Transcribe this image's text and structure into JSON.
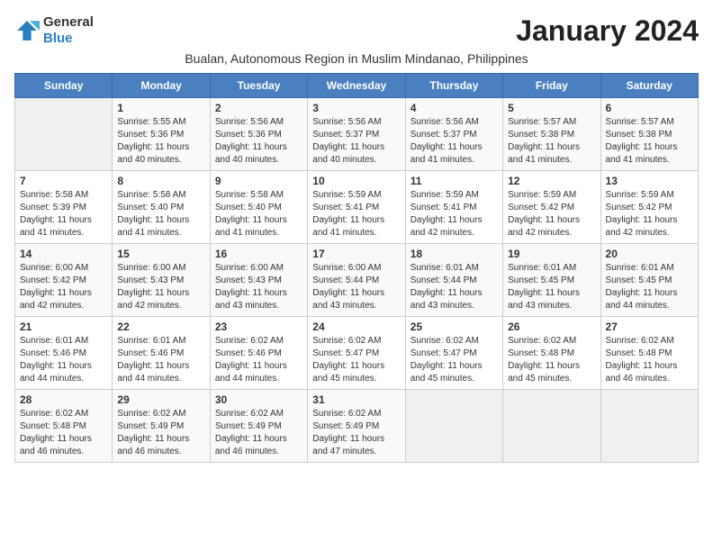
{
  "header": {
    "logo": {
      "general": "General",
      "blue": "Blue"
    },
    "month": "January 2024",
    "subtitle": "Bualan, Autonomous Region in Muslim Mindanao, Philippines"
  },
  "days_of_week": [
    "Sunday",
    "Monday",
    "Tuesday",
    "Wednesday",
    "Thursday",
    "Friday",
    "Saturday"
  ],
  "weeks": [
    [
      {
        "day": "",
        "detail": ""
      },
      {
        "day": "1",
        "detail": "Sunrise: 5:55 AM\nSunset: 5:36 PM\nDaylight: 11 hours\nand 40 minutes."
      },
      {
        "day": "2",
        "detail": "Sunrise: 5:56 AM\nSunset: 5:36 PM\nDaylight: 11 hours\nand 40 minutes."
      },
      {
        "day": "3",
        "detail": "Sunrise: 5:56 AM\nSunset: 5:37 PM\nDaylight: 11 hours\nand 40 minutes."
      },
      {
        "day": "4",
        "detail": "Sunrise: 5:56 AM\nSunset: 5:37 PM\nDaylight: 11 hours\nand 41 minutes."
      },
      {
        "day": "5",
        "detail": "Sunrise: 5:57 AM\nSunset: 5:38 PM\nDaylight: 11 hours\nand 41 minutes."
      },
      {
        "day": "6",
        "detail": "Sunrise: 5:57 AM\nSunset: 5:38 PM\nDaylight: 11 hours\nand 41 minutes."
      }
    ],
    [
      {
        "day": "7",
        "detail": "Sunrise: 5:58 AM\nSunset: 5:39 PM\nDaylight: 11 hours\nand 41 minutes."
      },
      {
        "day": "8",
        "detail": "Sunrise: 5:58 AM\nSunset: 5:40 PM\nDaylight: 11 hours\nand 41 minutes."
      },
      {
        "day": "9",
        "detail": "Sunrise: 5:58 AM\nSunset: 5:40 PM\nDaylight: 11 hours\nand 41 minutes."
      },
      {
        "day": "10",
        "detail": "Sunrise: 5:59 AM\nSunset: 5:41 PM\nDaylight: 11 hours\nand 41 minutes."
      },
      {
        "day": "11",
        "detail": "Sunrise: 5:59 AM\nSunset: 5:41 PM\nDaylight: 11 hours\nand 42 minutes."
      },
      {
        "day": "12",
        "detail": "Sunrise: 5:59 AM\nSunset: 5:42 PM\nDaylight: 11 hours\nand 42 minutes."
      },
      {
        "day": "13",
        "detail": "Sunrise: 5:59 AM\nSunset: 5:42 PM\nDaylight: 11 hours\nand 42 minutes."
      }
    ],
    [
      {
        "day": "14",
        "detail": "Sunrise: 6:00 AM\nSunset: 5:42 PM\nDaylight: 11 hours\nand 42 minutes."
      },
      {
        "day": "15",
        "detail": "Sunrise: 6:00 AM\nSunset: 5:43 PM\nDaylight: 11 hours\nand 42 minutes."
      },
      {
        "day": "16",
        "detail": "Sunrise: 6:00 AM\nSunset: 5:43 PM\nDaylight: 11 hours\nand 43 minutes."
      },
      {
        "day": "17",
        "detail": "Sunrise: 6:00 AM\nSunset: 5:44 PM\nDaylight: 11 hours\nand 43 minutes."
      },
      {
        "day": "18",
        "detail": "Sunrise: 6:01 AM\nSunset: 5:44 PM\nDaylight: 11 hours\nand 43 minutes."
      },
      {
        "day": "19",
        "detail": "Sunrise: 6:01 AM\nSunset: 5:45 PM\nDaylight: 11 hours\nand 43 minutes."
      },
      {
        "day": "20",
        "detail": "Sunrise: 6:01 AM\nSunset: 5:45 PM\nDaylight: 11 hours\nand 44 minutes."
      }
    ],
    [
      {
        "day": "21",
        "detail": "Sunrise: 6:01 AM\nSunset: 5:46 PM\nDaylight: 11 hours\nand 44 minutes."
      },
      {
        "day": "22",
        "detail": "Sunrise: 6:01 AM\nSunset: 5:46 PM\nDaylight: 11 hours\nand 44 minutes."
      },
      {
        "day": "23",
        "detail": "Sunrise: 6:02 AM\nSunset: 5:46 PM\nDaylight: 11 hours\nand 44 minutes."
      },
      {
        "day": "24",
        "detail": "Sunrise: 6:02 AM\nSunset: 5:47 PM\nDaylight: 11 hours\nand 45 minutes."
      },
      {
        "day": "25",
        "detail": "Sunrise: 6:02 AM\nSunset: 5:47 PM\nDaylight: 11 hours\nand 45 minutes."
      },
      {
        "day": "26",
        "detail": "Sunrise: 6:02 AM\nSunset: 5:48 PM\nDaylight: 11 hours\nand 45 minutes."
      },
      {
        "day": "27",
        "detail": "Sunrise: 6:02 AM\nSunset: 5:48 PM\nDaylight: 11 hours\nand 46 minutes."
      }
    ],
    [
      {
        "day": "28",
        "detail": "Sunrise: 6:02 AM\nSunset: 5:48 PM\nDaylight: 11 hours\nand 46 minutes."
      },
      {
        "day": "29",
        "detail": "Sunrise: 6:02 AM\nSunset: 5:49 PM\nDaylight: 11 hours\nand 46 minutes."
      },
      {
        "day": "30",
        "detail": "Sunrise: 6:02 AM\nSunset: 5:49 PM\nDaylight: 11 hours\nand 46 minutes."
      },
      {
        "day": "31",
        "detail": "Sunrise: 6:02 AM\nSunset: 5:49 PM\nDaylight: 11 hours\nand 47 minutes."
      },
      {
        "day": "",
        "detail": ""
      },
      {
        "day": "",
        "detail": ""
      },
      {
        "day": "",
        "detail": ""
      }
    ]
  ]
}
